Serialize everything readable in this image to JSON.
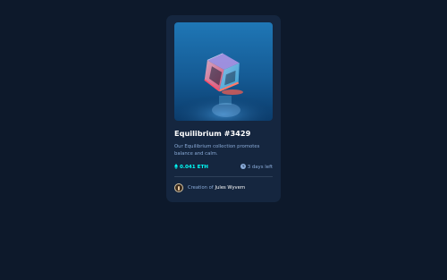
{
  "card": {
    "title": "Equilibrium #3429",
    "description": "Our Equilibrium collection promotes balance and calm.",
    "price": "0.041 ETH",
    "time_left": "3 days left",
    "creator_prefix": "Creation of",
    "creator_name": "Jules Wyvern"
  },
  "icons": {
    "price": "ethereum-icon",
    "time": "clock-icon"
  },
  "colors": {
    "page_background": "#0d192b",
    "card_background": "#15263f",
    "accent_cyan": "#00fff8",
    "soft_blue_text": "#8bacd9",
    "white_text": "#ffffff",
    "divider": "#2e405a"
  }
}
